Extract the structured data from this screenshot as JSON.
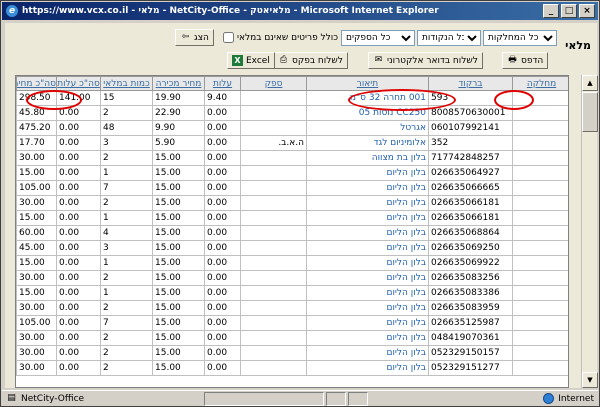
{
  "window": {
    "title": "https://www.vcx.co.il - מלאי - NetCity-Office - מלאיאטק - Microsoft Internet Explorer",
    "min_label": "_",
    "max_label": "□",
    "close_label": "×"
  },
  "app": {
    "label": "מלאי"
  },
  "filters": {
    "departments": "כל המחלקות",
    "points": "כל הנקודות",
    "suppliers": "כל הספקים",
    "include_zero_label": "כולל פריטים שאינם במלאי"
  },
  "buttons": {
    "show": "הצג",
    "print": "הדפס",
    "email": "לשלוח בדואר אלקטרוני",
    "order": "לשלוח בפקס",
    "excel": "Excel"
  },
  "table": {
    "columns": [
      "מחלקה",
      "ברקוד",
      "תיאור",
      "ספק",
      "עלות",
      "מחיר מכירה",
      "כמות במלאי",
      "סה\"כ עלות",
      "סה\"כ מחירה"
    ],
    "rows": [
      [
        "",
        "593",
        "001 תחרה 32 ס\"מ",
        "",
        "9.40",
        "19.90",
        "15",
        "141.00",
        "298.50"
      ],
      [
        "",
        "8008570630001",
        "CC250 נוסות 05",
        "",
        "0.00",
        "22.90",
        "2",
        "0.00",
        "45.80"
      ],
      [
        "",
        "060107992141",
        "אגרטל",
        "",
        "0.00",
        "9.90",
        "48",
        "0.00",
        "475.20"
      ],
      [
        "",
        "352",
        "אלומיניום לגד",
        "ה.א.ב.",
        "0.00",
        "5.90",
        "3",
        "0.00",
        "17.70"
      ],
      [
        "",
        "717742848257",
        "בלון בת מצווה",
        "",
        "0.00",
        "15.00",
        "2",
        "0.00",
        "30.00"
      ],
      [
        "",
        "026635064927",
        "בלון הליום",
        "",
        "0.00",
        "15.00",
        "1",
        "0.00",
        "15.00"
      ],
      [
        "",
        "026635066665",
        "בלון הליום",
        "",
        "0.00",
        "15.00",
        "7",
        "0.00",
        "105.00"
      ],
      [
        "",
        "026635066181",
        "בלון הליום",
        "",
        "0.00",
        "15.00",
        "2",
        "0.00",
        "30.00"
      ],
      [
        "",
        "026635066181",
        "בלון הליום",
        "",
        "0.00",
        "15.00",
        "1",
        "0.00",
        "15.00"
      ],
      [
        "",
        "026635068864",
        "בלון הליום",
        "",
        "0.00",
        "15.00",
        "4",
        "0.00",
        "60.00"
      ],
      [
        "",
        "026635069250",
        "בלון הליום",
        "",
        "0.00",
        "15.00",
        "3",
        "0.00",
        "45.00"
      ],
      [
        "",
        "026635069922",
        "בלון הליום",
        "",
        "0.00",
        "15.00",
        "1",
        "0.00",
        "15.00"
      ],
      [
        "",
        "026635083256",
        "בלון הליום",
        "",
        "0.00",
        "15.00",
        "2",
        "0.00",
        "30.00"
      ],
      [
        "",
        "026635083386",
        "בלון הליום",
        "",
        "0.00",
        "15.00",
        "1",
        "0.00",
        "15.00"
      ],
      [
        "",
        "026635083959",
        "בלון הליום",
        "",
        "0.00",
        "15.00",
        "2",
        "0.00",
        "30.00"
      ],
      [
        "",
        "026635125987",
        "בלון הליום",
        "",
        "0.00",
        "15.00",
        "7",
        "0.00",
        "105.00"
      ],
      [
        "",
        "048419070361",
        "בלון הליום",
        "",
        "0.00",
        "15.00",
        "2",
        "0.00",
        "30.00"
      ],
      [
        "",
        "052329150157",
        "בלון הליום",
        "",
        "0.00",
        "15.00",
        "2",
        "0.00",
        "30.00"
      ],
      [
        "",
        "052329151277",
        "בלון הליום",
        "",
        "0.00",
        "15.00",
        "2",
        "0.00",
        "30.00"
      ]
    ]
  },
  "status": {
    "left": "NetCity-Office",
    "zone": "Internet"
  },
  "colors": {
    "title_bar": "#0a246a",
    "link": "#1f5fb0",
    "annotation": "#e00000"
  }
}
